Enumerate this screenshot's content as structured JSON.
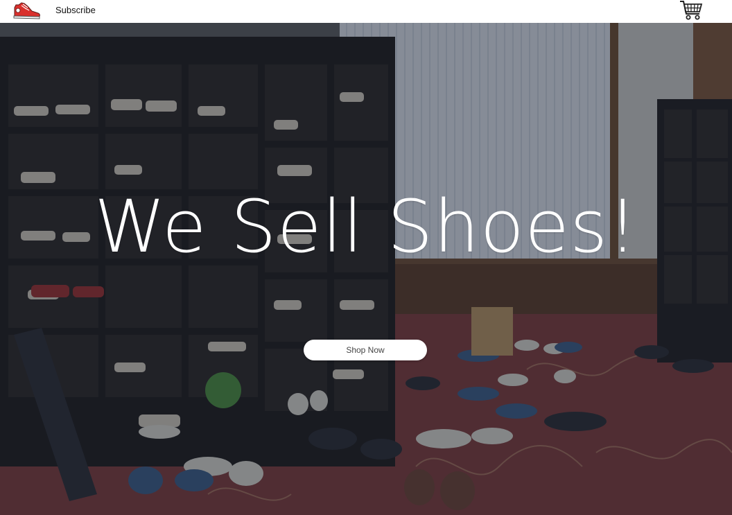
{
  "nav": {
    "logo_icon": "sneaker-logo-icon",
    "subscribe_label": "Subscribe",
    "cart_icon": "shopping-cart-icon"
  },
  "hero": {
    "title": "We Sell Shoes!",
    "cta_label": "Shop Now",
    "background_image": "shoe-store-shelves-photo"
  },
  "colors": {
    "navbar": "#ffffff",
    "overlay": "#141c30",
    "title": "#ffffff",
    "button_bg": "#ffffff",
    "button_text": "#444444",
    "logo_red": "#d9302c"
  }
}
